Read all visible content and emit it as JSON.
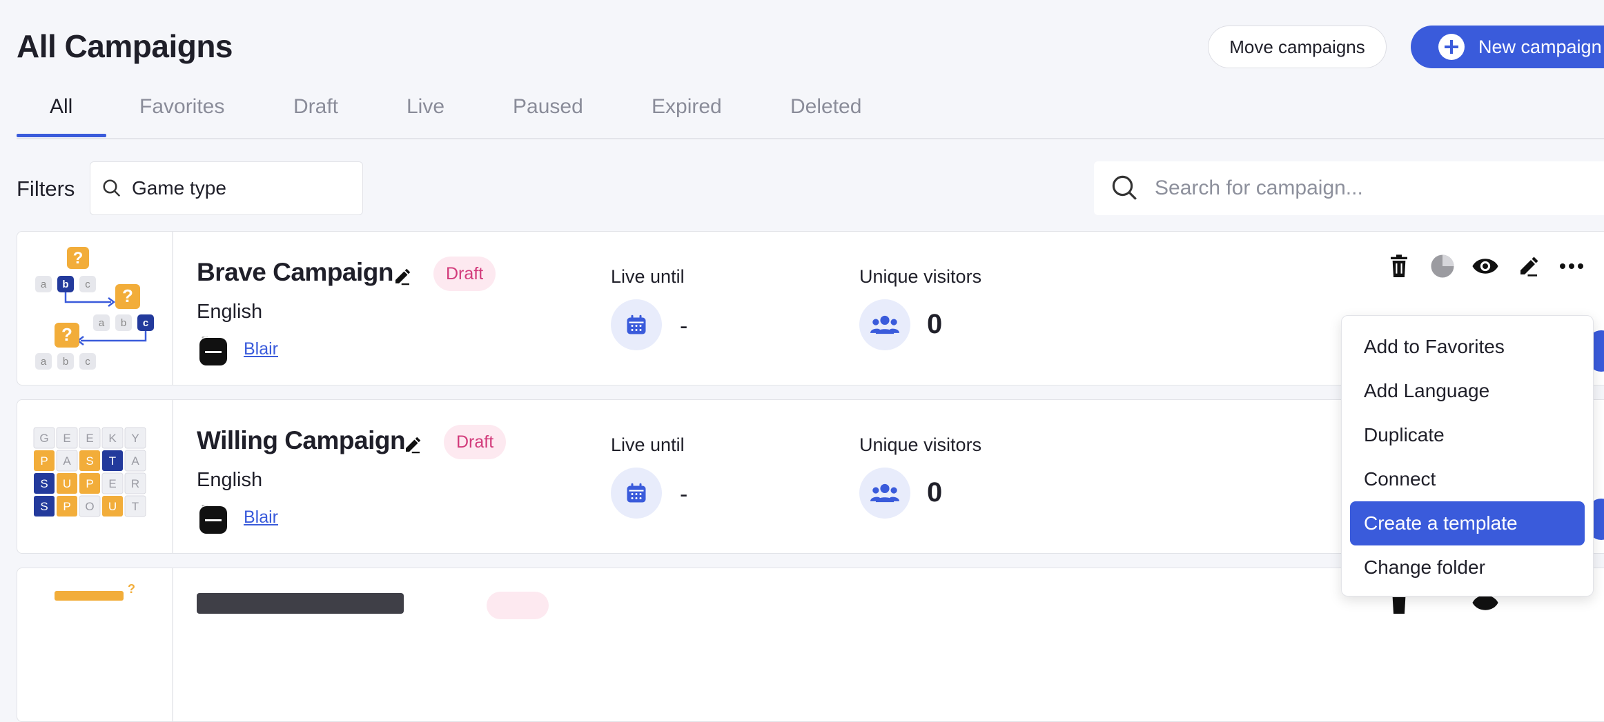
{
  "header": {
    "title": "All Campaigns",
    "move_label": "Move campaigns",
    "new_label": "New campaign"
  },
  "tabs": [
    "All",
    "Favorites",
    "Draft",
    "Live",
    "Paused",
    "Expired",
    "Deleted"
  ],
  "filters": {
    "label": "Filters",
    "game_type": "Game type",
    "search_placeholder": "Search for campaign..."
  },
  "campaigns": [
    {
      "name": "Brave Campaign",
      "status": "Draft",
      "language": "English",
      "owner": "Blair",
      "live_until_label": "Live until",
      "live_until": "-",
      "visitors_label": "Unique visitors",
      "visitors": "0"
    },
    {
      "name": "Willing Campaign",
      "status": "Draft",
      "language": "English",
      "owner": "Blair",
      "live_until_label": "Live until",
      "live_until": "-",
      "visitors_label": "Unique visitors",
      "visitors": "0"
    }
  ],
  "thumb1": {
    "row1": [
      "a",
      "b",
      "c"
    ],
    "row2": [
      "a",
      "b",
      "c"
    ],
    "row3": [
      "a",
      "b",
      "c"
    ],
    "q": "?"
  },
  "thumb2": {
    "grid": [
      [
        "G",
        "E",
        "E",
        "K",
        "Y"
      ],
      [
        "P",
        "A",
        "S",
        "T",
        "A"
      ],
      [
        "S",
        "U",
        "P",
        "E",
        "R"
      ],
      [
        "S",
        "P",
        "O",
        "U",
        "T"
      ]
    ]
  },
  "thumb3": {
    "q": "?"
  },
  "actions": [
    "trash-icon",
    "stats-icon",
    "eye-icon",
    "edit-icon",
    "more-icon"
  ],
  "menu": {
    "items": [
      "Add to Favorites",
      "Add Language",
      "Duplicate",
      "Connect",
      "Create a template",
      "Change folder"
    ],
    "highlighted": "Create a template"
  },
  "colors": {
    "accent": "#3a5bdb",
    "draft_bg": "#fde9f0",
    "draft_text": "#d23b7b",
    "tile_orange": "#f2ad3a",
    "tile_navy": "#233a9c"
  }
}
